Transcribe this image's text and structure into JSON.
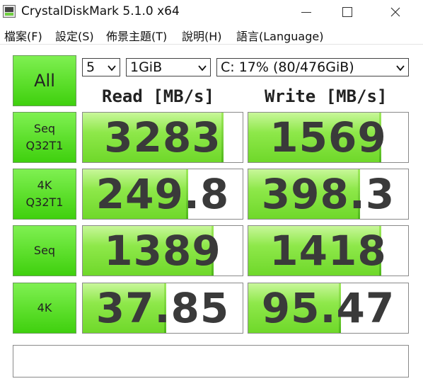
{
  "window": {
    "title": "CrystalDiskMark 5.1.0 x64"
  },
  "menu": [
    "檔案(F)",
    "設定(S)",
    "佈景主題(T)",
    "說明(H)",
    "語言(Language)"
  ],
  "controls": {
    "all_button": "All",
    "count": "5",
    "size": "1GiB",
    "drive": "C: 17% (80/476GiB)"
  },
  "headers": {
    "read": "Read [MB/s]",
    "write": "Write [MB/s]"
  },
  "tests": [
    {
      "label": "Seq\nQ32T1",
      "read": "3283",
      "write": "1569",
      "read_fill": 0.88,
      "write_fill": 0.83
    },
    {
      "label": "4K\nQ32T1",
      "read": "249.8",
      "write": "398.3",
      "read_fill": 0.66,
      "write_fill": 0.7
    },
    {
      "label": "Seq",
      "read": "1389",
      "write": "1418",
      "read_fill": 0.82,
      "write_fill": 0.83
    },
    {
      "label": "4K",
      "read": "37.85",
      "write": "95.47",
      "read_fill": 0.52,
      "write_fill": 0.58
    }
  ],
  "status_text": ""
}
